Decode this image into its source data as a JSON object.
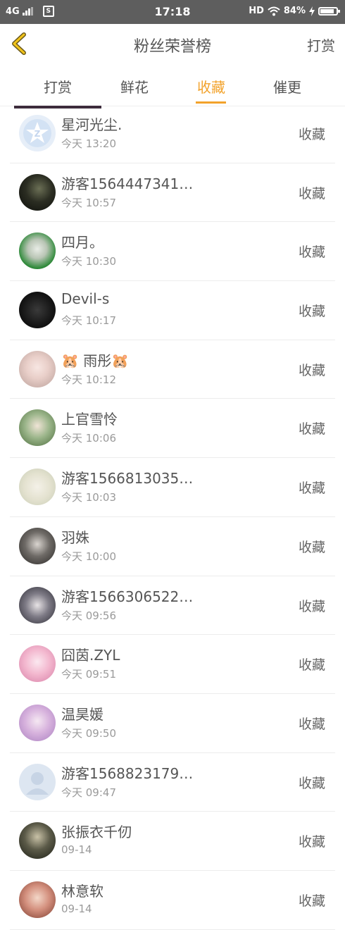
{
  "status_bar": {
    "network": "4G",
    "sim_icon": "S",
    "time": "17:18",
    "hd": "HD",
    "battery": "84%",
    "icons": [
      "signal-icon",
      "sim-icon",
      "wifi-icon",
      "charging-icon",
      "battery-icon"
    ]
  },
  "header": {
    "title": "粉丝荣誉榜",
    "right_action": "打赏",
    "back_icon": "chevron-left-icon",
    "accent_color": "#f2a22b"
  },
  "tabs": [
    {
      "label": "打赏",
      "active": false
    },
    {
      "label": "鲜花",
      "active": false
    },
    {
      "label": "收藏",
      "active": true
    },
    {
      "label": "催更",
      "active": false
    }
  ],
  "list": [
    {
      "name": "星河光尘.",
      "time": "今天 13:20",
      "action": "收藏",
      "avatar": "default-qq-avatar"
    },
    {
      "name": "游客1564447341…",
      "time": "今天 10:57",
      "action": "收藏",
      "avatar": "user-avatar"
    },
    {
      "name": "四月。",
      "time": "今天 10:30",
      "action": "收藏",
      "avatar": "user-avatar"
    },
    {
      "name": "Devil-s",
      "time": "今天 10:17",
      "action": "收藏",
      "avatar": "user-avatar"
    },
    {
      "name": "🐹 雨彤🐹",
      "time": "今天 10:12",
      "action": "收藏",
      "avatar": "user-avatar"
    },
    {
      "name": "上官雪怜",
      "time": "今天 10:06",
      "action": "收藏",
      "avatar": "user-avatar"
    },
    {
      "name": "游客1566813035…",
      "time": "今天 10:03",
      "action": "收藏",
      "avatar": "user-avatar"
    },
    {
      "name": "羽姝",
      "time": "今天 10:00",
      "action": "收藏",
      "avatar": "user-avatar"
    },
    {
      "name": "游客1566306522…",
      "time": "今天 09:56",
      "action": "收藏",
      "avatar": "user-avatar"
    },
    {
      "name": "囧茵.ZYL",
      "time": "今天 09:51",
      "action": "收藏",
      "avatar": "user-avatar"
    },
    {
      "name": "温昊媛",
      "time": "今天 09:50",
      "action": "收藏",
      "avatar": "user-avatar"
    },
    {
      "name": "游客1568823179…",
      "time": "今天 09:47",
      "action": "收藏",
      "avatar": "default-person-avatar"
    },
    {
      "name": "张振衣千仞",
      "time": "09-14",
      "action": "收藏",
      "avatar": "user-avatar"
    },
    {
      "name": "林意软",
      "time": "09-14",
      "action": "收藏",
      "avatar": "user-avatar"
    }
  ]
}
